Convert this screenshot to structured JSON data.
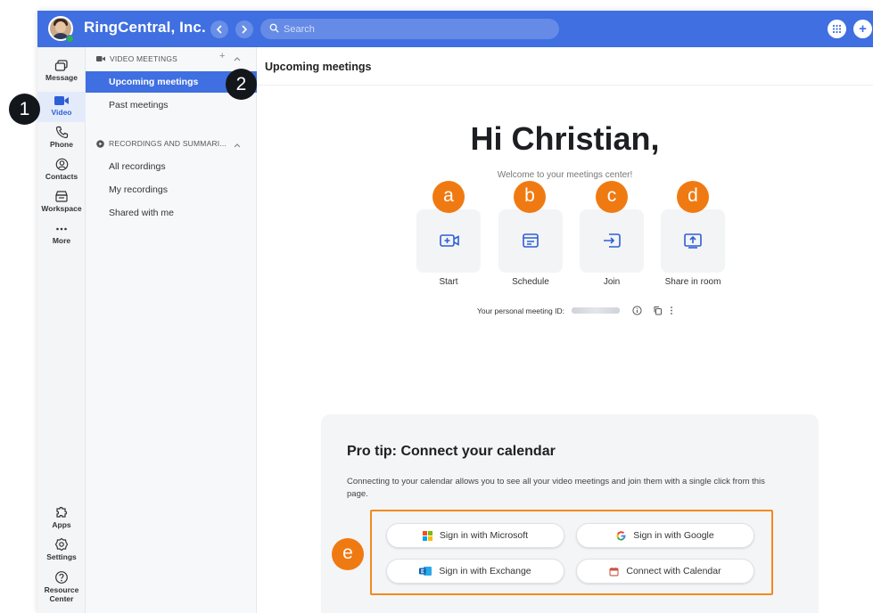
{
  "app": {
    "org_name": "RingCentral, Inc.",
    "search_placeholder": "Search",
    "plus_icon_glyph": "+"
  },
  "rail": {
    "items": [
      {
        "label": "Message",
        "icon": "message-icon"
      },
      {
        "label": "Video",
        "icon": "video-icon",
        "active": true
      },
      {
        "label": "Phone",
        "icon": "phone-icon"
      },
      {
        "label": "Contacts",
        "icon": "contacts-icon"
      },
      {
        "label": "Workspace",
        "icon": "workspace-icon"
      },
      {
        "label": "More",
        "icon": "more-icon"
      }
    ],
    "bottom": [
      {
        "label": "Apps",
        "icon": "apps-icon"
      },
      {
        "label": "Settings",
        "icon": "settings-icon"
      },
      {
        "label_line1": "Resource",
        "label_line2": "Center",
        "icon": "help-icon"
      }
    ]
  },
  "sidebar": {
    "video_section": "VIDEO MEETINGS",
    "items": [
      "Upcoming meetings",
      "Past meetings"
    ],
    "recordings_section": "RECORDINGS AND SUMMARI...",
    "recording_items": [
      "All recordings",
      "My recordings",
      "Shared with me"
    ]
  },
  "main": {
    "title": "Upcoming meetings",
    "greeting": "Hi Christian,",
    "welcome": "Welcome to your meetings center!",
    "actions": [
      {
        "label": "Start",
        "icon": "start-meeting-icon"
      },
      {
        "label": "Schedule",
        "icon": "schedule-icon"
      },
      {
        "label": "Join",
        "icon": "join-icon"
      },
      {
        "label": "Share in room",
        "icon": "share-room-icon"
      }
    ],
    "personal_id_label": "Your personal meeting ID:"
  },
  "card": {
    "title": "Pro tip: Connect your calendar",
    "description": "Connecting to your calendar allows you to see all your video meetings and join them with a single click from this page.",
    "buttons": [
      {
        "label": "Sign in with Microsoft",
        "icon": "microsoft-icon"
      },
      {
        "label": "Sign in with Google",
        "icon": "google-icon"
      },
      {
        "label": "Sign in with Exchange",
        "icon": "exchange-icon"
      },
      {
        "label": "Connect with Calendar",
        "icon": "calendar-icon"
      }
    ]
  },
  "annotations": {
    "numbers": [
      "1",
      "2"
    ],
    "letters": [
      "a",
      "b",
      "c",
      "d",
      "e"
    ]
  },
  "colors": {
    "brand_blue": "#3f6fe0",
    "accent_orange": "#f07a12",
    "badge_dark": "#13171c"
  }
}
